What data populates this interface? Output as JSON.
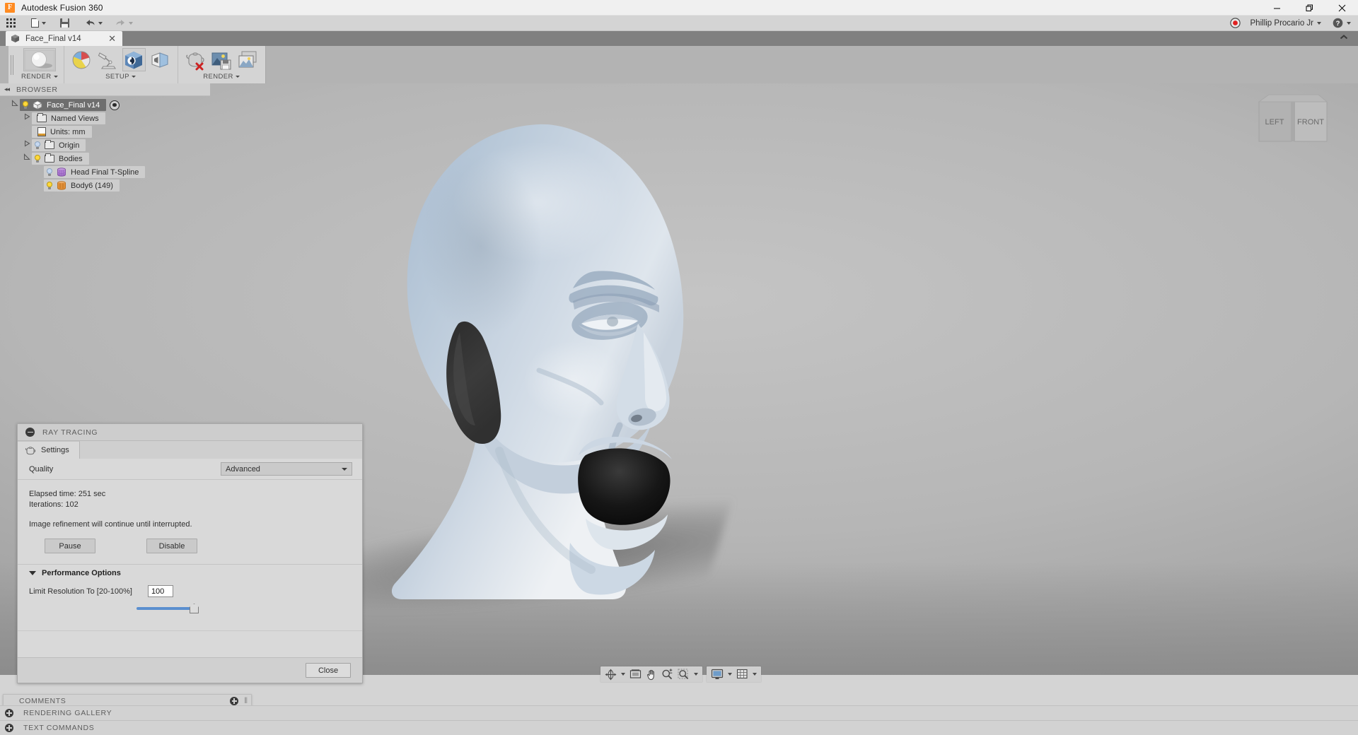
{
  "app": {
    "title": "Autodesk Fusion 360",
    "logo_icon": "fusion-logo-icon",
    "window_controls": [
      {
        "name": "minimize-button",
        "glyph": "—"
      },
      {
        "name": "restore-button",
        "glyph": "❐"
      },
      {
        "name": "close-button",
        "glyph": "✕"
      }
    ]
  },
  "quick_access": {
    "items": [
      {
        "name": "app-grid-button",
        "icon": "grid-apps-icon",
        "caret": false
      },
      {
        "name": "file-menu-button",
        "icon": "document-icon",
        "caret": true
      },
      {
        "name": "save-button",
        "icon": "save-icon",
        "caret": false
      },
      {
        "name": "undo-button",
        "icon": "undo-arrow-icon",
        "caret": true
      },
      {
        "name": "redo-button",
        "icon": "redo-arrow-icon",
        "caret": true
      }
    ]
  },
  "account": {
    "record_indicator": "record-dot-icon",
    "user_name": "Phillip Procario Jr",
    "help_label": "?"
  },
  "tab": {
    "label": "Face_Final v14",
    "close_glyph": "✕",
    "collapse_glyph": "⌃"
  },
  "ribbon": {
    "panels": [
      {
        "label": "RENDER",
        "has_caret": true,
        "buttons": [
          {
            "name": "render-appearance-preview-button",
            "icon": "sphere-preview-icon",
            "active": true
          }
        ]
      },
      {
        "label": "SETUP",
        "has_caret": true,
        "buttons": [
          {
            "name": "appearance-button",
            "icon": "color-palette-sphere-icon"
          },
          {
            "name": "scene-settings-button",
            "icon": "desk-lamp-icon"
          },
          {
            "name": "decal-button",
            "icon": "blue-cube-decal-icon",
            "active": true
          },
          {
            "name": "texture-map-controls-button",
            "icon": "open-book-panel-icon"
          }
        ]
      },
      {
        "label": "RENDER",
        "has_caret": true,
        "buttons": [
          {
            "name": "in-canvas-render-button",
            "icon": "teapot-cancel-icon"
          },
          {
            "name": "render-button",
            "icon": "image-save-icon"
          },
          {
            "name": "render-gallery-button",
            "icon": "image-gallery-icon"
          }
        ]
      }
    ]
  },
  "browser": {
    "header": "BROWSER",
    "collapse_glyph": "◂◂",
    "tree": [
      {
        "name": "browser-node-document",
        "label": "Face_Final v14",
        "indent": 0,
        "arrow": "expanded",
        "bulb": "on",
        "icon": "cube-icon",
        "selected": true,
        "has_target": true
      },
      {
        "name": "browser-node-named-views",
        "label": "Named Views",
        "indent": 1,
        "arrow": "collapsed",
        "bulb": "none",
        "icon": "folder-icon",
        "selected": false,
        "has_target": false
      },
      {
        "name": "browser-node-units",
        "label": "Units: mm",
        "indent": 1,
        "arrow": "none",
        "bulb": "none",
        "icon": "units-document-icon",
        "selected": false,
        "has_target": false
      },
      {
        "name": "browser-node-origin",
        "label": "Origin",
        "indent": 1,
        "arrow": "collapsed",
        "bulb": "off",
        "icon": "folder-icon",
        "selected": false,
        "has_target": false
      },
      {
        "name": "browser-node-bodies",
        "label": "Bodies",
        "indent": 1,
        "arrow": "expanded",
        "bulb": "on",
        "icon": "folder-icon",
        "selected": false,
        "has_target": false
      },
      {
        "name": "browser-node-head-final-tspline",
        "label": "Head Final T-Spline",
        "indent": 2,
        "arrow": "none",
        "bulb": "off",
        "icon": "tspline-body-icon",
        "selected": false,
        "has_target": false
      },
      {
        "name": "browser-node-body6",
        "label": "Body6 (149)",
        "indent": 2,
        "arrow": "none",
        "bulb": "on",
        "icon": "solid-body-icon",
        "selected": false,
        "has_target": false
      }
    ]
  },
  "viewcube": {
    "left_face": "LEFT",
    "front_face": "FRONT"
  },
  "ray_tracing_dialog": {
    "title": "RAY TRACING",
    "collapse_icon": "minus-circle-icon",
    "tab_label": "Settings",
    "tab_icon": "teapot-icon",
    "quality_label": "Quality",
    "quality_value": "Advanced",
    "quality_options": [
      "Advanced"
    ],
    "elapsed_time": "Elapsed time: 251 sec",
    "iterations": "Iterations: 102",
    "refinement_note": "Image refinement will continue until interrupted.",
    "pause_label": "Pause",
    "disable_label": "Disable",
    "performance_header": "Performance Options",
    "limit_resolution_label": "Limit Resolution To [20-100%]",
    "limit_resolution_value": "100",
    "slider_percent": 100,
    "close_label": "Close"
  },
  "navbar": {
    "groups": [
      {
        "name": "navigation-group",
        "buttons": [
          {
            "name": "orbit-button",
            "icon": "orbit-icon",
            "caret": true
          },
          {
            "name": "look-at-button",
            "icon": "look-at-icon",
            "caret": false
          },
          {
            "name": "pan-button",
            "icon": "pan-hand-icon",
            "caret": false
          },
          {
            "name": "zoom-button",
            "icon": "zoom-plus-minus-icon",
            "caret": false
          },
          {
            "name": "fit-button",
            "icon": "zoom-window-icon",
            "caret": true
          }
        ]
      },
      {
        "name": "display-group",
        "buttons": [
          {
            "name": "display-settings-button",
            "icon": "monitor-icon",
            "caret": true
          },
          {
            "name": "grid-snaps-button",
            "icon": "grid-icon",
            "caret": true
          }
        ]
      }
    ]
  },
  "bottom_panels": [
    {
      "name": "comments-panel",
      "label": "COMMENTS",
      "icon": "plus-circle-icon"
    },
    {
      "name": "rendering-gallery-panel",
      "label": "RENDERING GALLERY",
      "icon": "plus-circle-icon"
    },
    {
      "name": "text-commands-panel",
      "label": "TEXT COMMANDS",
      "icon": "plus-circle-icon"
    }
  ],
  "colors": {
    "accent_orange": "#ff8b22",
    "slider_blue": "#5b8fcf",
    "model_surface": "#b6c6d6",
    "record_red": "#e02020"
  }
}
